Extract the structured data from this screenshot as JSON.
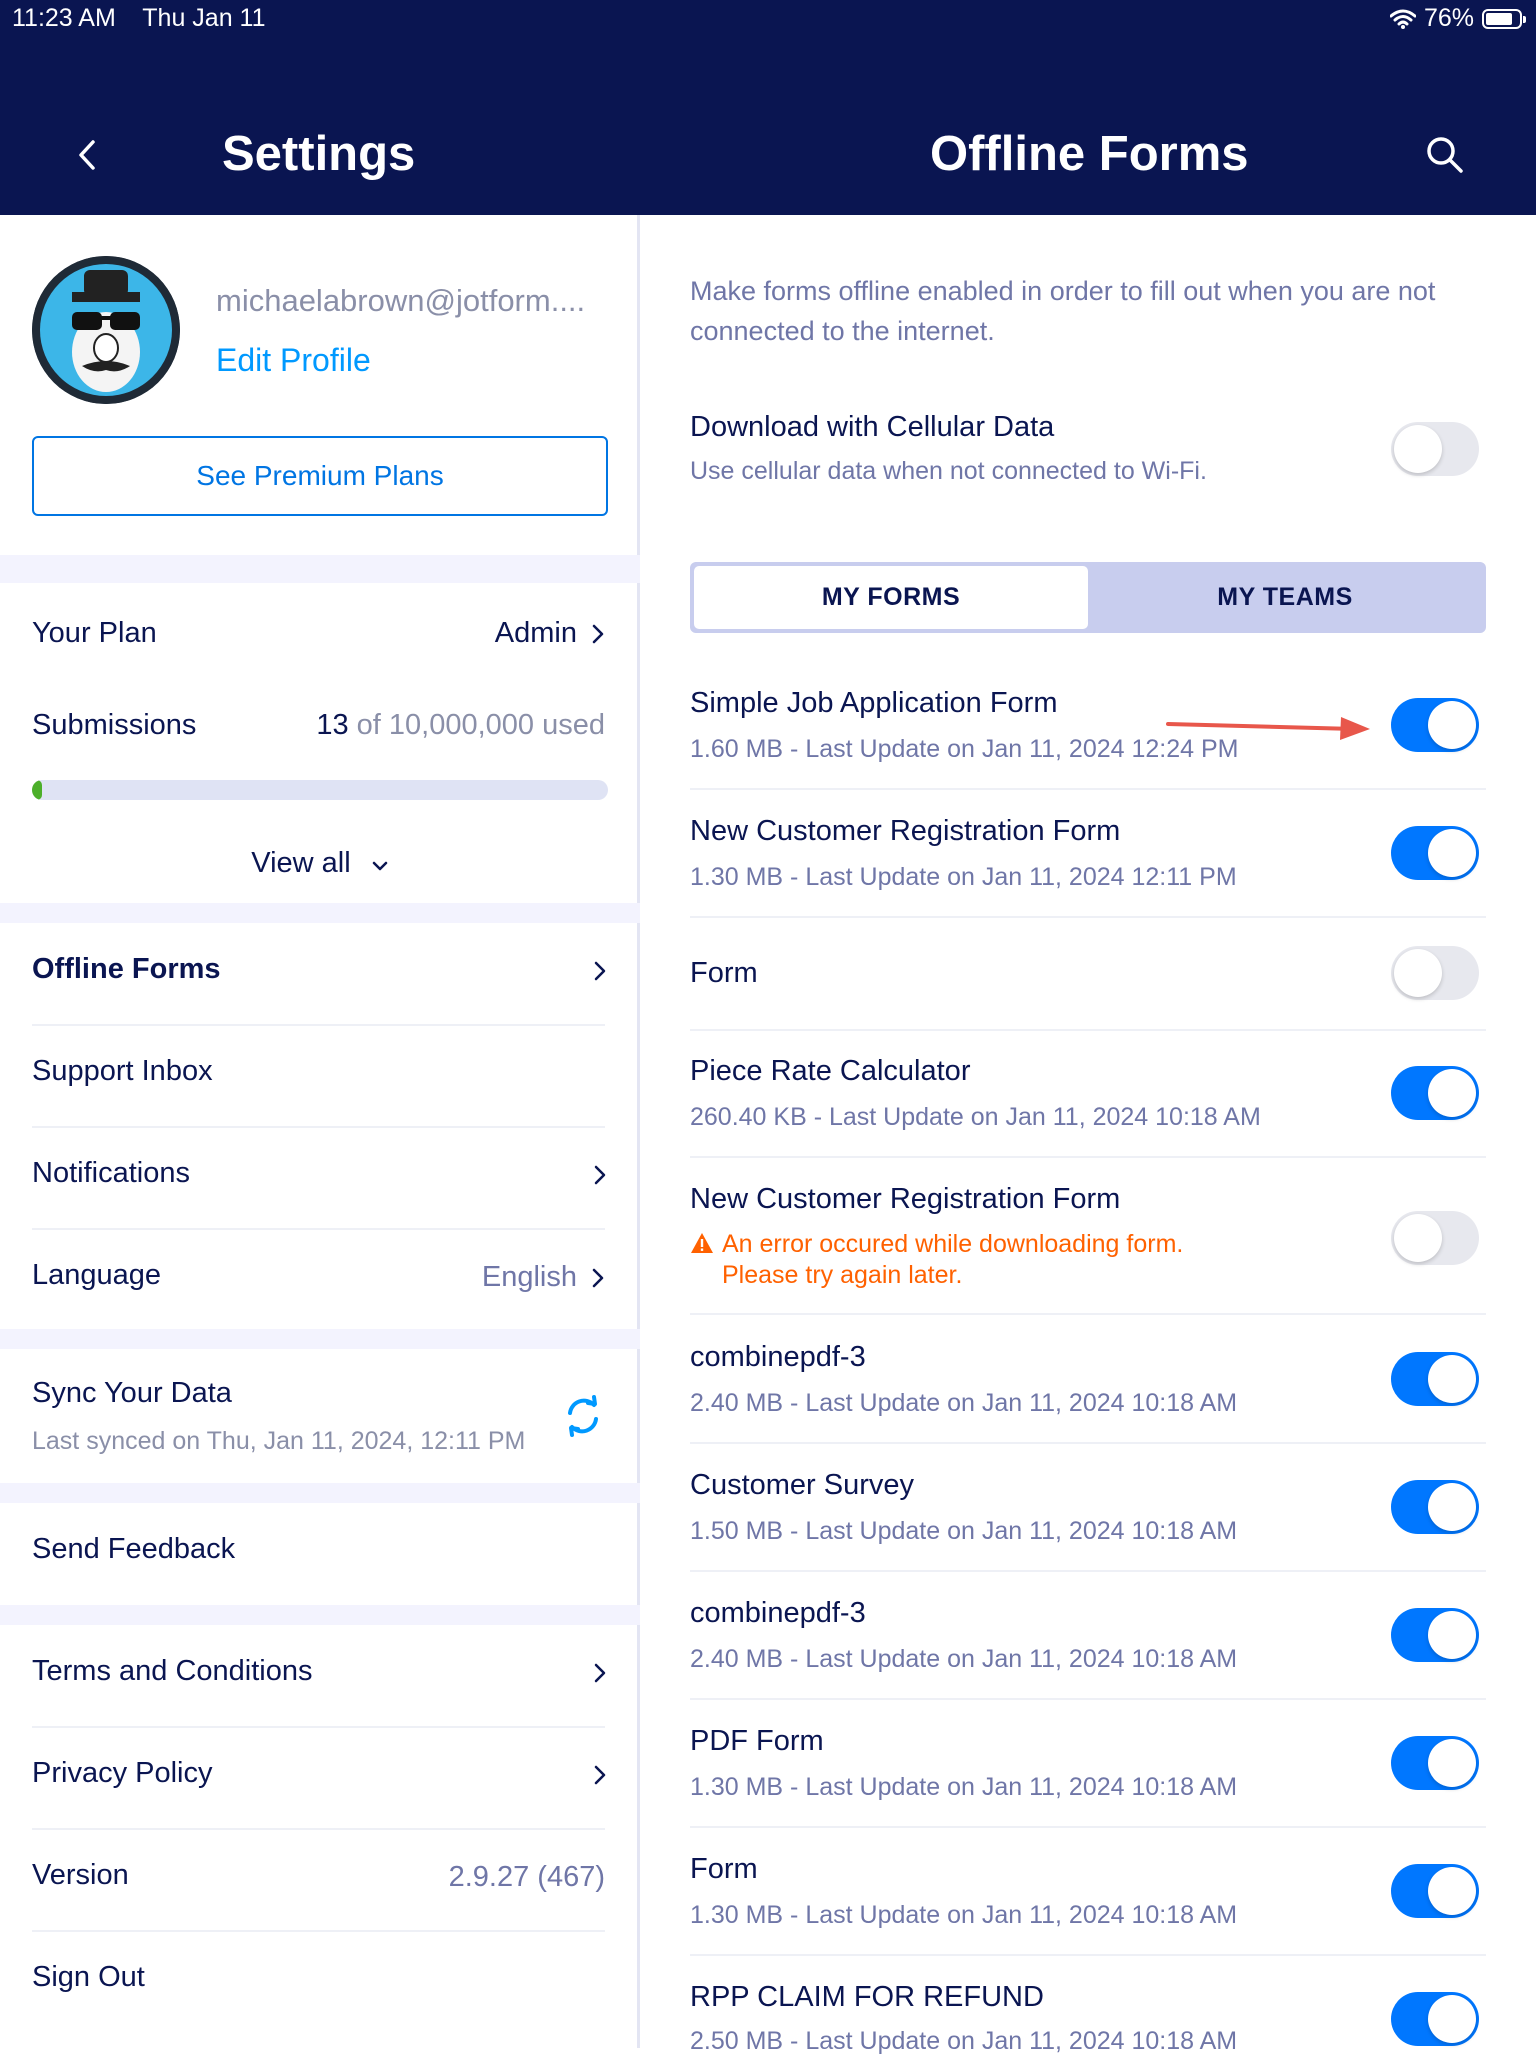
{
  "status_bar": {
    "time": "11:23 AM",
    "date": "Thu Jan 11",
    "battery": "76%",
    "battery_fraction": 0.76
  },
  "left_header": {
    "title": "Settings"
  },
  "right_header": {
    "title": "Offline Forms"
  },
  "profile": {
    "email": "michaelabrown@jotform....",
    "edit_profile": "Edit Profile",
    "premium_button": "See Premium Plans"
  },
  "plan": {
    "your_plan_label": "Your Plan",
    "your_plan_value": "Admin",
    "submissions_label": "Submissions",
    "submissions_used": "13",
    "submissions_total": "of 10,000,000 used",
    "submissions_fraction": 1.3e-06,
    "view_all": "View all"
  },
  "menu": {
    "offline_forms": "Offline Forms",
    "support_inbox": "Support Inbox",
    "notifications": "Notifications",
    "language_label": "Language",
    "language_value": "English",
    "sync_title": "Sync Your Data",
    "sync_sub": "Last synced on Thu, Jan 11, 2024, 12:11 PM",
    "send_feedback": "Send Feedback",
    "terms": "Terms and Conditions",
    "privacy": "Privacy Policy",
    "version_label": "Version",
    "version_value": "2.9.27 (467)",
    "sign_out": "Sign Out"
  },
  "offline": {
    "intro": "Make forms offline enabled in order to fill out when you are not connected to the internet.",
    "cellular_title": "Download with Cellular Data",
    "cellular_sub": "Use cellular data when not connected to Wi-Fi.",
    "cellular_on": false,
    "tabs": {
      "my_forms": "MY FORMS",
      "my_teams": "MY TEAMS",
      "active": "MY FORMS"
    },
    "forms": [
      {
        "title": "Simple Job Application Form",
        "sub": "1.60 MB - Last Update on Jan 11, 2024 12:24 PM",
        "on": true
      },
      {
        "title": "New Customer Registration Form",
        "sub": "1.30 MB - Last Update on Jan 11, 2024 12:11 PM",
        "on": true
      },
      {
        "title": "Form",
        "sub": "",
        "on": false
      },
      {
        "title": "Piece Rate Calculator",
        "sub": "260.40 KB - Last Update on Jan 11, 2024 10:18 AM",
        "on": true
      },
      {
        "title": "New Customer Registration Form",
        "error1": "An error occured while downloading form.",
        "error2": "Please try again later.",
        "on": false
      },
      {
        "title": "combinepdf-3",
        "sub": "2.40 MB - Last Update on Jan 11, 2024 10:18 AM",
        "on": true
      },
      {
        "title": "Customer Survey",
        "sub": "1.50 MB - Last Update on Jan 11, 2024 10:18 AM",
        "on": true
      },
      {
        "title": "combinepdf-3",
        "sub": "2.40 MB - Last Update on Jan 11, 2024 10:18 AM",
        "on": true
      },
      {
        "title": "PDF Form",
        "sub": "1.30 MB - Last Update on Jan 11, 2024 10:18 AM",
        "on": true
      },
      {
        "title": "Form",
        "sub": "1.30 MB - Last Update on Jan 11, 2024 10:18 AM",
        "on": true
      },
      {
        "title": "RPP CLAIM FOR REFUND",
        "sub": "2.50 MB - Last Update on Jan 11, 2024 10:18 AM",
        "on": true
      }
    ]
  },
  "colors": {
    "navy": "#0a1551",
    "accent_blue": "#0077ff",
    "link_blue": "#0099ff",
    "error_orange": "#ff6100",
    "annotation_arrow": "#e8574b"
  },
  "icons": {
    "back": "chevron-left-icon",
    "search": "search-icon",
    "wifi": "wifi-icon",
    "battery": "battery-icon",
    "chevron": "chevron-right-icon",
    "view_all": "chevron-down-icon",
    "sync": "sync-icon",
    "warning": "warning-icon",
    "arrow": "annotation-arrow"
  }
}
